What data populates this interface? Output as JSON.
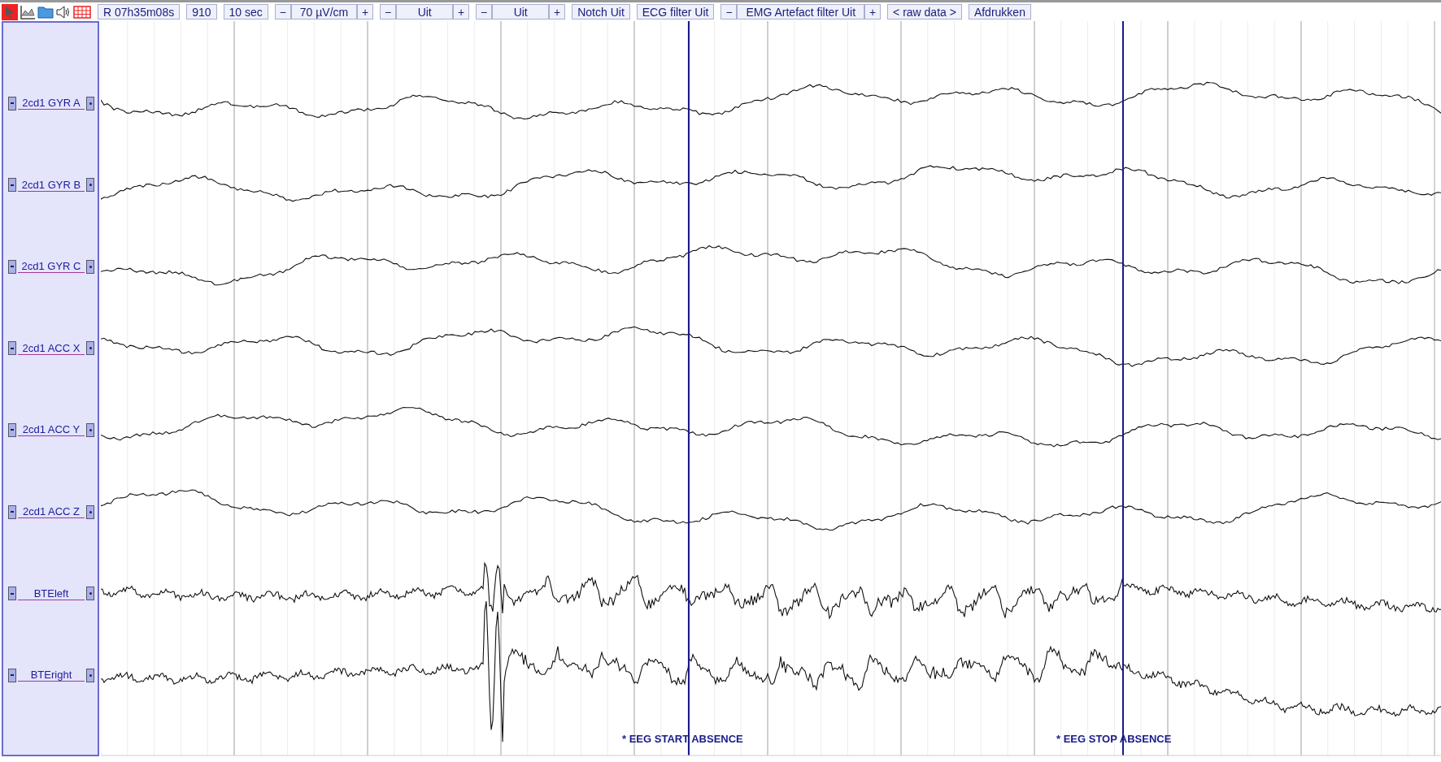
{
  "toolbar": [
    {
      "kind": "readout",
      "text": "R 07h35m08s"
    },
    {
      "kind": "readout",
      "text": "910"
    },
    {
      "kind": "readout",
      "text": "10 sec"
    },
    {
      "kind": "stepper",
      "decrease": "−",
      "value": "70 µV/cm",
      "increase": "+"
    },
    {
      "kind": "stepper",
      "decrease": "−",
      "value": "Uit",
      "increase": "+"
    },
    {
      "kind": "stepper",
      "decrease": "−",
      "value": "Uit",
      "increase": "+"
    },
    {
      "kind": "button",
      "text": "Notch Uit"
    },
    {
      "kind": "button",
      "text": "ECG filter Uit"
    },
    {
      "kind": "stepper",
      "decrease": "−",
      "value": "EMG Artefact filter Uit",
      "increase": "+"
    },
    {
      "kind": "button",
      "text": "< raw data >"
    },
    {
      "kind": "button",
      "text": "Afdrukken"
    }
  ],
  "channels": [
    {
      "name": "2cd1 GYR A",
      "kind": "motion"
    },
    {
      "name": "2cd1 GYR B",
      "kind": "motion"
    },
    {
      "name": "2cd1 GYR C",
      "kind": "motion"
    },
    {
      "name": "2cd1 ACC X",
      "kind": "motion"
    },
    {
      "name": "2cd1 ACC Y",
      "kind": "motion"
    },
    {
      "name": "2cd1 ACC Z",
      "kind": "motion"
    },
    {
      "name": "BTEleft",
      "kind": "eeg"
    },
    {
      "name": "BTEright",
      "kind": "eeg"
    }
  ],
  "markers": [
    {
      "label": "* EEG START ABSENCE"
    },
    {
      "label": "* EEG STOP ABSENCE"
    }
  ]
}
